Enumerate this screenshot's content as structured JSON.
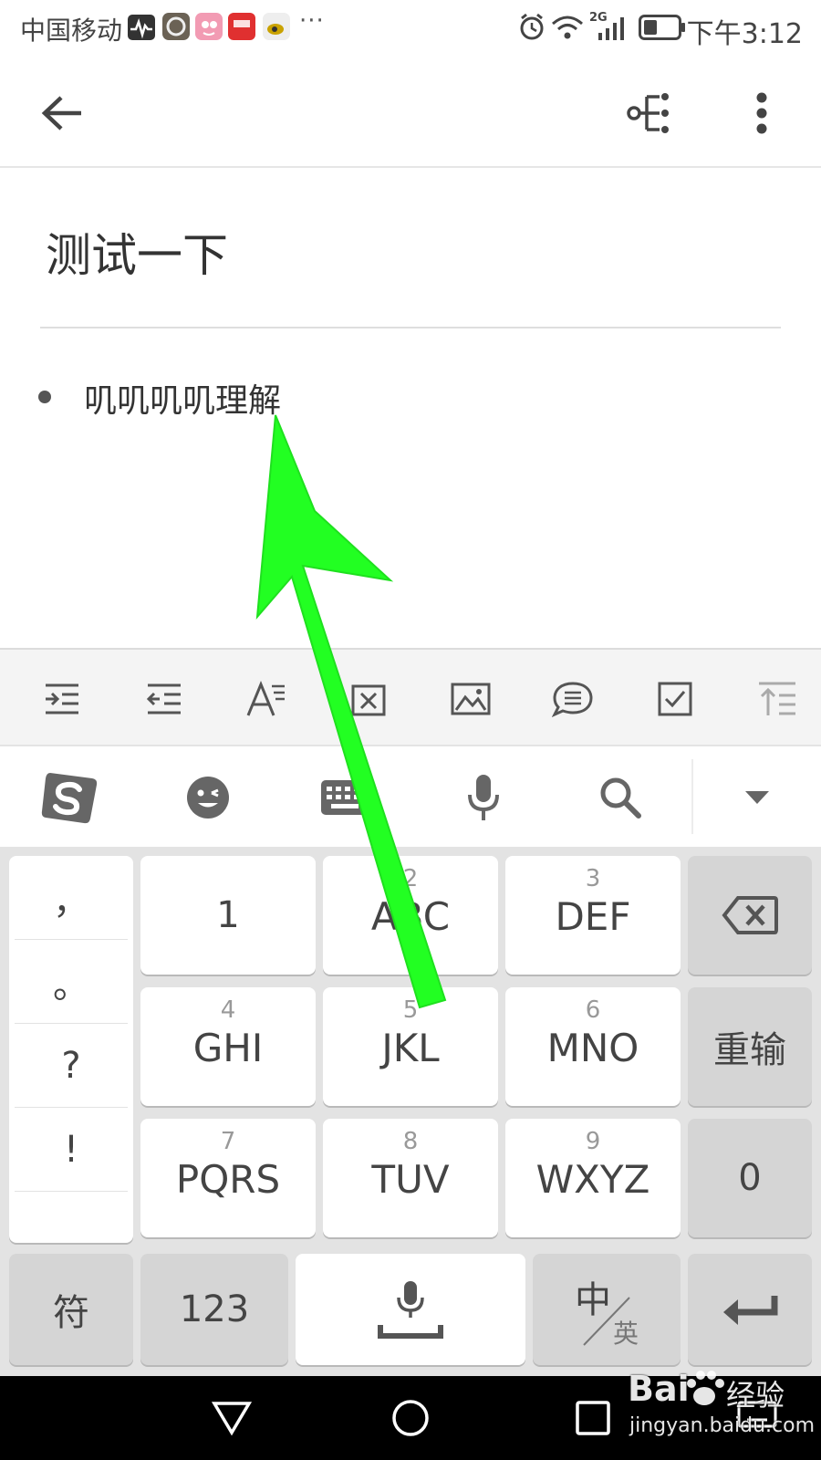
{
  "status_bar": {
    "carrier": "中国移动",
    "network": "2G",
    "time": "下午3:12"
  },
  "note": {
    "title": "测试一下",
    "bullet_item": "叽叽叽叽理解"
  },
  "keyboard": {
    "punctuation": [
      "，",
      "。",
      "?",
      "!"
    ],
    "keys_row1": [
      {
        "num": "",
        "letters": "1"
      },
      {
        "num": "2",
        "letters": "ABC"
      },
      {
        "num": "3",
        "letters": "DEF"
      }
    ],
    "keys_row2": [
      {
        "num": "4",
        "letters": "GHI"
      },
      {
        "num": "5",
        "letters": "JKL"
      },
      {
        "num": "6",
        "letters": "MNO"
      }
    ],
    "keys_row3": [
      {
        "num": "7",
        "letters": "PQRS"
      },
      {
        "num": "8",
        "letters": "TUV"
      },
      {
        "num": "9",
        "letters": "WXYZ"
      }
    ],
    "reenter": "重输",
    "zero": "0",
    "symbols": "符",
    "num123": "123",
    "lang_zh": "中",
    "lang_en": "英"
  },
  "watermark": {
    "brand": "Bai",
    "brand_suffix": "经验",
    "url": "jingyan.baidu.com"
  },
  "colors": {
    "annotation_arrow": "#22ff22",
    "icon_gray": "#555555",
    "key_gray": "#d5d5d5"
  }
}
